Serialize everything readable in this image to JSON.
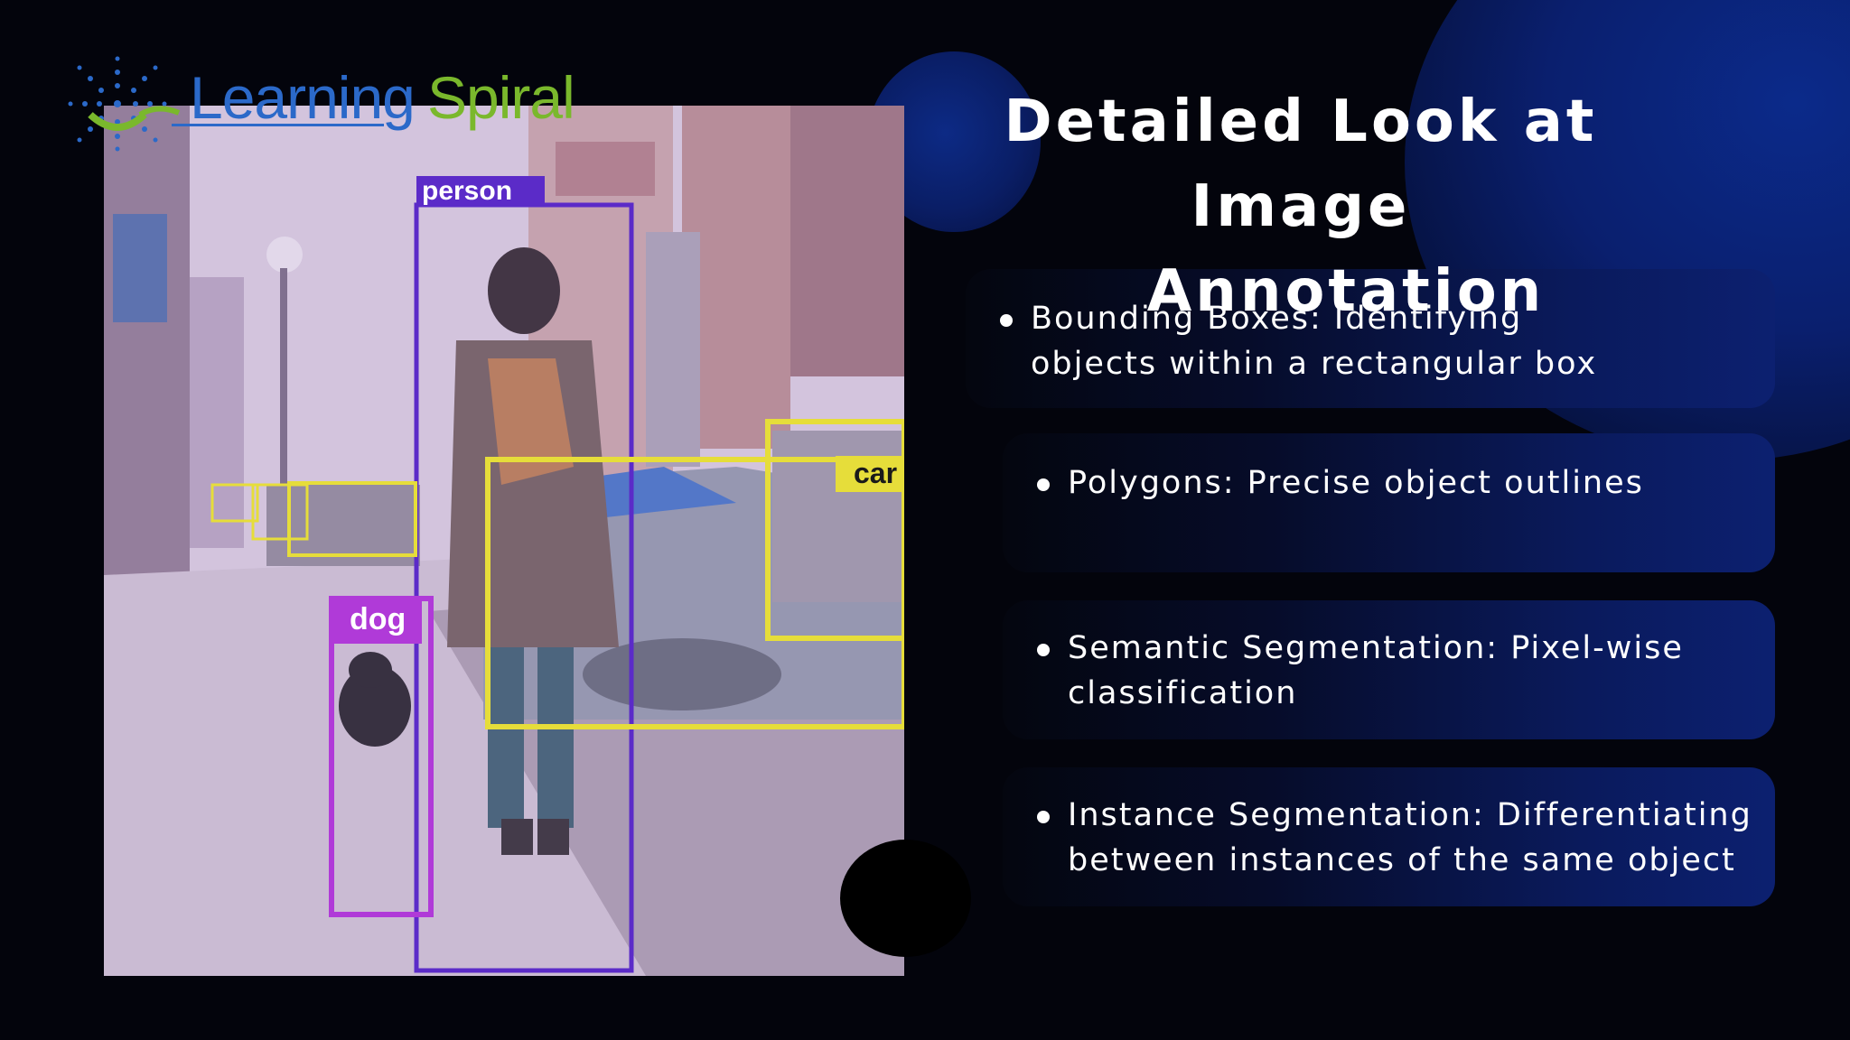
{
  "logo": {
    "word1": "Learning",
    "word2": "Spiral"
  },
  "title": {
    "line1": "Detailed Look at",
    "line2": "Image",
    "line3": "Annotation"
  },
  "photo": {
    "labels": {
      "person": "person",
      "dog": "dog",
      "car": "car"
    }
  },
  "bullets": [
    {
      "line1": "Bounding Boxes: Identifying",
      "line2": "objects within a rectangular box"
    },
    {
      "line1": "Polygons: Precise object outlines",
      "line2": ""
    },
    {
      "line1": "Semantic Segmentation: Pixel-wise",
      "line2": "classification"
    },
    {
      "line1": "Instance Segmentation: Differentiating",
      "line2": "between instances of the same object"
    }
  ],
  "colors": {
    "background": "#03040c",
    "card_accent": "#0c2070",
    "person_box": "#5b2bc8",
    "dog_box": "#b03ad8",
    "car_box": "#e6dd3a",
    "logo_blue": "#2b69c9",
    "logo_green": "#7ab82c"
  }
}
